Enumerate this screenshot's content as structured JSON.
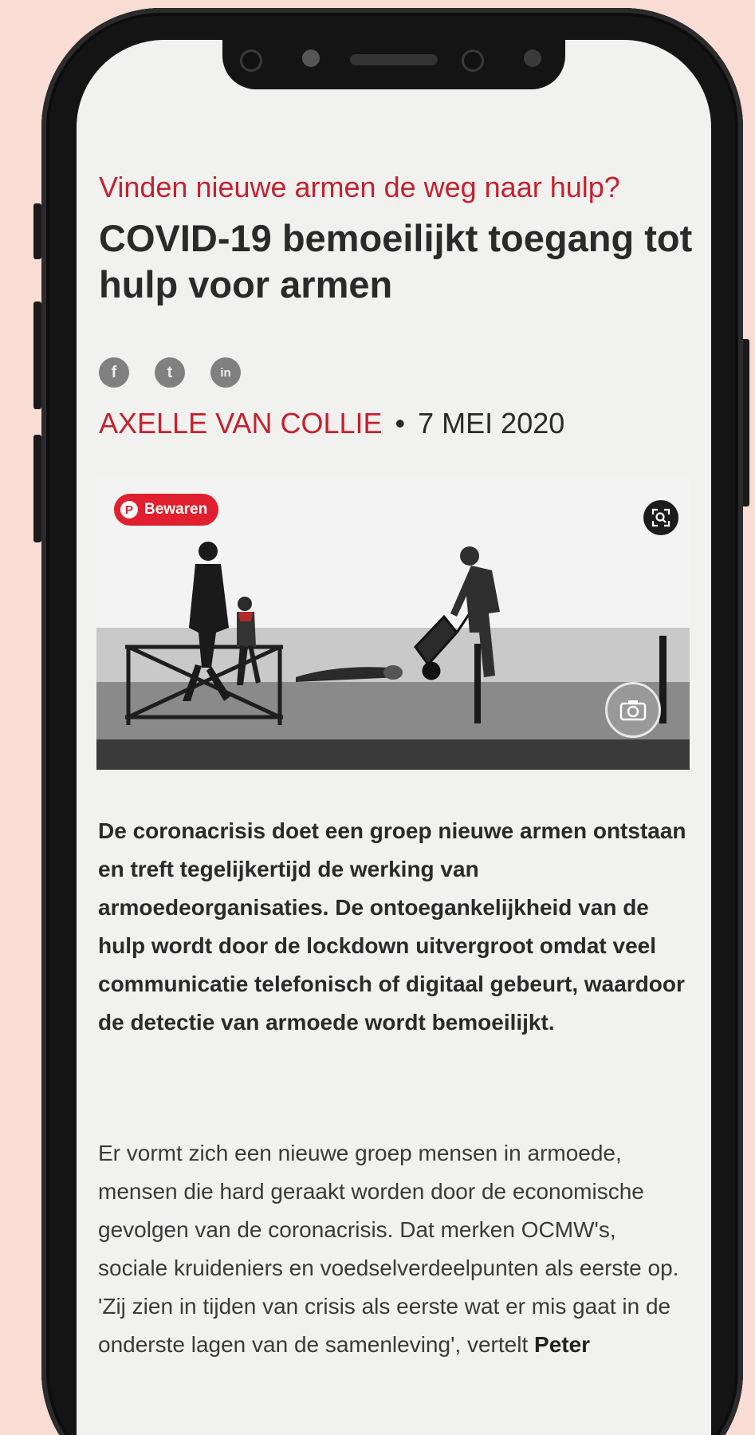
{
  "article": {
    "kicker": "Vinden nieuwe armen de weg naar hulp?",
    "headline": "COVID-19 bemoeilijkt toegang tot hulp voor armen",
    "author": "AXELLE VAN COLLIE",
    "separator": "•",
    "date": "7 MEI 2020",
    "lead": "De coronacrisis doet een groep nieuwe armen ontstaan en treft tegelijkertijd de werking van armoedeorganisaties. De ontoegankelijkheid van de hulp wordt door de lockdown uitvergroot omdat veel communicatie telefonisch of digitaal gebeurt, waardoor de detectie van armoede wordt bemoeilijkt.",
    "body": "Er vormt zich een nieuwe groep mensen in armoede, mensen die hard geraakt worden door de economische gevolgen van de coronacrisis. Dat merken OCMW's, sociale kruideniers en voedselverdeelpunten als eerste op. 'Zij zien in tijden van crisis als eerste wat er mis gaat in de onderste lagen van de samenleving', vertelt",
    "body_bold": "Peter"
  },
  "share": {
    "icons": [
      {
        "name": "facebook-icon",
        "glyph": "f"
      },
      {
        "name": "twitter-icon",
        "glyph": "t"
      },
      {
        "name": "linkedin-icon",
        "glyph": "in"
      }
    ]
  },
  "photo": {
    "save_label": "Bewaren",
    "save_glyph": "P"
  },
  "colors": {
    "accent": "#c4222e",
    "text": "#2a2a2a",
    "background": "#f9dcd4",
    "screen": "#f1f1f0"
  }
}
